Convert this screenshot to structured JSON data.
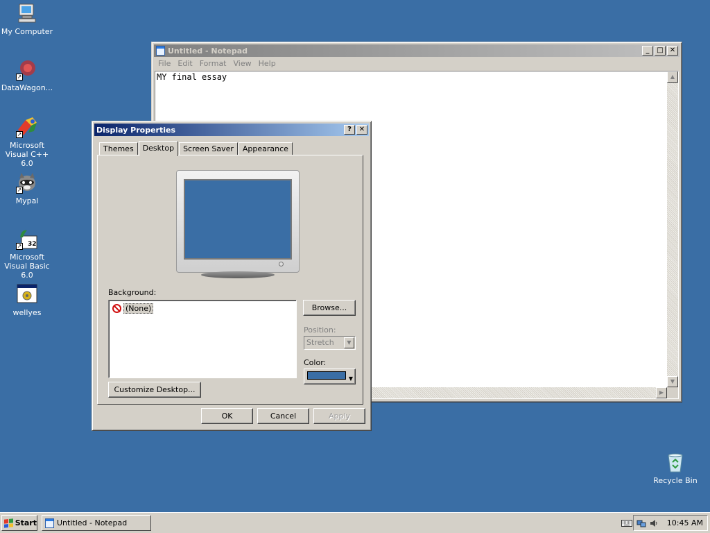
{
  "desktop": {
    "icons": [
      {
        "label": "My Computer",
        "icon": "my-computer-icon"
      },
      {
        "label": "DataWagon...",
        "icon": "datawagon-icon"
      },
      {
        "label": "Microsoft Visual C++ 6.0",
        "icon": "visual-cpp-icon"
      },
      {
        "label": "Mypal",
        "icon": "mypal-raccoon-icon"
      },
      {
        "label": "Microsoft Visual Basic 6.0",
        "icon": "visual-basic-icon"
      },
      {
        "label": "wellyes",
        "icon": "wellyes-app-icon"
      },
      {
        "label": "Recycle Bin",
        "icon": "recycle-bin-icon"
      }
    ],
    "background_color": "#3a6ea5"
  },
  "notepad": {
    "title": "Untitled - Notepad",
    "menu": [
      "File",
      "Edit",
      "Format",
      "View",
      "Help"
    ],
    "content": "MY final essay"
  },
  "display_properties": {
    "title": "Display Properties",
    "tabs": [
      "Themes",
      "Desktop",
      "Screen Saver",
      "Appearance"
    ],
    "selected_tab": "Desktop",
    "background_label": "Background:",
    "background_items": [
      "(None)"
    ],
    "browse_label": "Browse...",
    "position_label": "Position:",
    "position_value": "Stretch",
    "color_label": "Color:",
    "color_value": "#3a6ea5",
    "customize_label": "Customize Desktop...",
    "ok_label": "OK",
    "cancel_label": "Cancel",
    "apply_label": "Apply"
  },
  "taskbar": {
    "start_label": "Start",
    "tasks": [
      "Untitled - Notepad"
    ],
    "clock": "10:45 AM"
  }
}
